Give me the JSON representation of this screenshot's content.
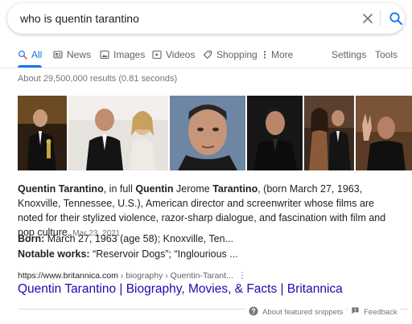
{
  "search": {
    "query": "who is quentin tarantino"
  },
  "tabs": [
    {
      "label": "All",
      "icon": "search-icon"
    },
    {
      "label": "News",
      "icon": "news-icon"
    },
    {
      "label": "Images",
      "icon": "image-icon"
    },
    {
      "label": "Videos",
      "icon": "video-icon"
    },
    {
      "label": "Shopping",
      "icon": "tag-icon"
    },
    {
      "label": "More",
      "icon": "more-vert-icon"
    }
  ],
  "tools": {
    "settings": "Settings",
    "tools": "Tools"
  },
  "result_stats": "About 29,500,000 results (0.81 seconds)",
  "snippet": {
    "name": "Quentin Tarantino",
    "t1": ", in full ",
    "first": "Quentin",
    "t2": " Jerome ",
    "last": "Tarantino",
    "t3": ", (born March 27, 1963, Knoxville, Tennessee, U.S.), American director and screenwriter whose films are noted for their stylized violence, razor-sharp dialogue, and fascination with film and pop culture.",
    "date": "Mar 23, 2021"
  },
  "facts": [
    {
      "key": "Born:",
      "value": " March 27, 1963 (age 58); Knoxville, Ten..."
    },
    {
      "key": "Notable works:",
      "value": " “Reservoir Dogs”; “Inglourious ..."
    }
  ],
  "citation": {
    "domain": "https://www.britannica.com",
    "path": " › biography › Quentin-Tarant...",
    "menu": "⋮"
  },
  "result_title": "Quentin Tarantino | Biography, Movies, & Facts | Britannica",
  "footer": {
    "about": "About featured snippets",
    "feedback": "Feedback"
  },
  "colors": {
    "link": "#1a0dab",
    "accent": "#1a73e8",
    "muted": "#70757a"
  }
}
